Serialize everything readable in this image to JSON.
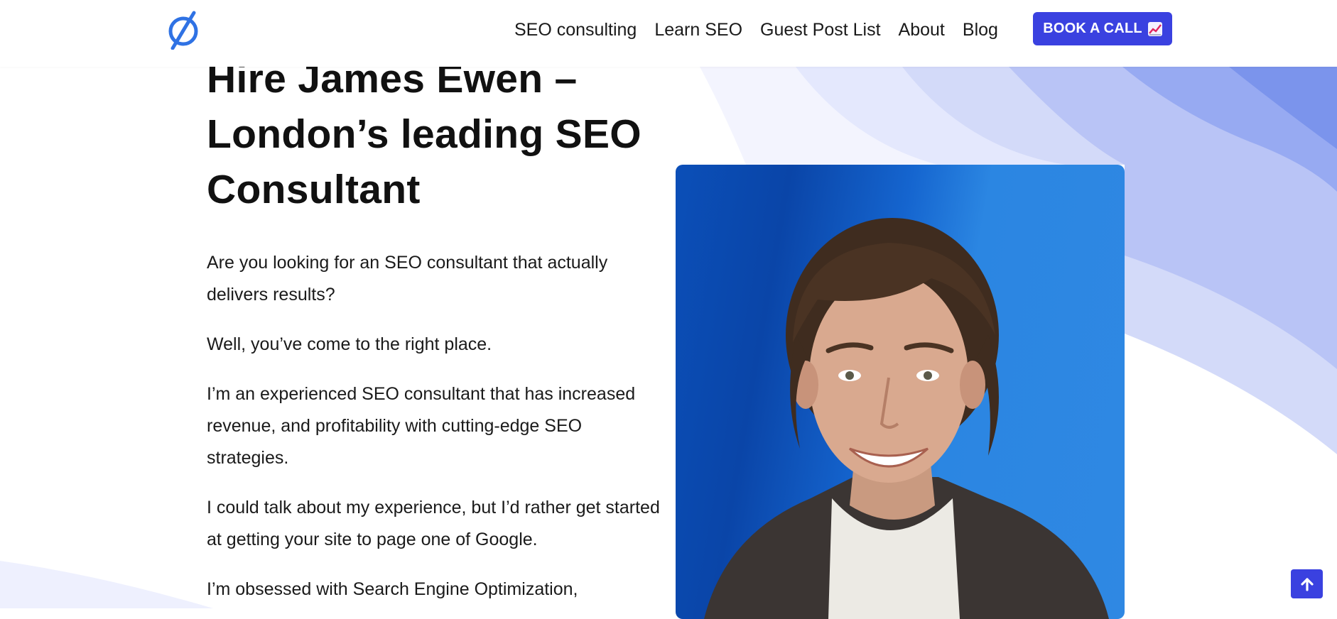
{
  "header": {
    "logo_icon": "slashed-circle-logo-icon",
    "nav": [
      {
        "label": "SEO consulting"
      },
      {
        "label": "Learn SEO"
      },
      {
        "label": "Guest Post List"
      },
      {
        "label": "About"
      },
      {
        "label": "Blog"
      }
    ],
    "cta_label": "BOOK A CALL",
    "cta_icon": "chart-increasing-icon"
  },
  "hero": {
    "title": "Hire James Ewen – London’s leading SEO Consultant",
    "paragraphs": [
      "Are you looking for an SEO consultant that actually delivers results?",
      "Well, you’ve come to the right place.",
      "I’m an experienced SEO consultant that has increased revenue, and profitability with cutting-edge SEO strategies.",
      "I could talk about my experience, but I’d rather get started at getting your site to page one of Google.",
      "I’m obsessed with Search Engine Optimization,"
    ],
    "photo": "portrait-photo"
  },
  "scroll_top_icon": "arrow-up-icon",
  "colors": {
    "accent": "#3a41e0",
    "logo": "#2f72e4",
    "photo_background": "#2f88e3",
    "wave_light": "#eef0fe",
    "wave_mid": "#bfc8f8",
    "wave_dark": "#7d95ed"
  }
}
